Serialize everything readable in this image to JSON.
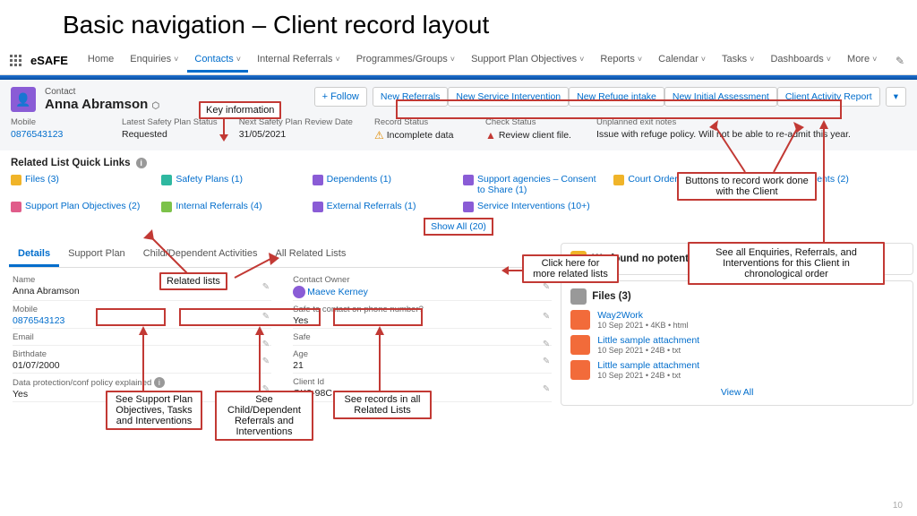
{
  "slide": {
    "title": "Basic navigation – Client record layout",
    "page": "10"
  },
  "brand": "eSAFE",
  "nav": {
    "items": [
      "Home",
      "Enquiries",
      "Contacts",
      "Internal Referrals",
      "Programmes/Groups",
      "Support Plan Objectives",
      "Reports",
      "Calendar",
      "Tasks",
      "Dashboards",
      "More"
    ],
    "active": "Contacts"
  },
  "contact": {
    "label": "Contact",
    "name": "Anna Abramson"
  },
  "actions": {
    "follow": "+ Follow",
    "buttons": [
      "New Referrals",
      "New Service Intervention",
      "New Refuge intake",
      "New Initial Assessment",
      "Client Activity Report"
    ]
  },
  "fields": [
    {
      "label": "Mobile",
      "value": "0876543123",
      "link": true
    },
    {
      "label": "Latest Safety Plan Status",
      "value": "Requested"
    },
    {
      "label": "Next Safety Plan Review Date",
      "value": "31/05/2021"
    },
    {
      "label": "Record Status",
      "value": "Incomplete data",
      "icon": "warn"
    },
    {
      "label": "Check Status",
      "value": "Review client file.",
      "icon": "err"
    },
    {
      "label": "Unplanned exit notes",
      "value": "Issue with refuge policy. Will not be able to re-admit this year."
    }
  ],
  "related": {
    "title": "Related List Quick Links",
    "links": [
      {
        "label": "Files (3)",
        "color": "#f0b429"
      },
      {
        "label": "Safety Plans (1)",
        "color": "#2eb8a0"
      },
      {
        "label": "Dependents (1)",
        "color": "#8a5cd6"
      },
      {
        "label": "Support agencies – Consent to Share (1)",
        "color": "#8a5cd6"
      },
      {
        "label": "Court Orders (2)",
        "color": "#f0b429"
      },
      {
        "label": "Assessments (2)",
        "color": "#e05c8a"
      },
      {
        "label": "Support Plan Objectives (2)",
        "color": "#e05c8a"
      },
      {
        "label": "Internal Referrals (4)",
        "color": "#7cc24a"
      },
      {
        "label": "External Referrals (1)",
        "color": "#8a5cd6"
      },
      {
        "label": "Service Interventions (10+)",
        "color": "#8a5cd6"
      }
    ],
    "show_all": "Show All (20)"
  },
  "tabs": [
    "Details",
    "Support Plan",
    "Child/Dependent Activities",
    "All Related Lists"
  ],
  "details": {
    "left": [
      {
        "label": "Name",
        "value": "Anna Abramson"
      },
      {
        "label": "Mobile",
        "value": "0876543123",
        "link": true
      },
      {
        "label": "Email",
        "value": ""
      },
      {
        "label": "Birthdate",
        "value": "01/07/2000"
      },
      {
        "label": "Data protection/conf policy explained",
        "value": "Yes",
        "info": true
      }
    ],
    "right": [
      {
        "label": "Contact Owner",
        "value": "Maeve Kerney",
        "link": true,
        "avatar": true
      },
      {
        "label": "Safe to contact on phone number?",
        "value": "Yes"
      },
      {
        "label": "Safe",
        "value": ""
      },
      {
        "label": "Age",
        "value": "21"
      },
      {
        "label": "Client Id",
        "value": "GK3-98C"
      }
    ]
  },
  "dupe": "We found no potential duplicates of this Contact.",
  "files": {
    "title": "Files (3)",
    "items": [
      {
        "name": "Way2Work",
        "meta": "10 Sep 2021 • 4KB • html"
      },
      {
        "name": "Little sample attachment",
        "meta": "10 Sep 2021 • 24B • txt"
      },
      {
        "name": "Little sample attachment",
        "meta": "10 Sep 2021 • 24B • txt"
      }
    ],
    "view_all": "View All"
  },
  "annots": {
    "key_info": "Key information",
    "buttons_work": "Buttons to record work done with the Client",
    "click_more": "Click here for more related lists",
    "see_all_enq": "See all Enquiries, Referrals, and Interventions for this Client in chronological order",
    "related_lists": "Related lists",
    "see_support": "See Support Plan Objectives, Tasks and Interventions",
    "see_child": "See Child/Dependent Referrals and Interventions",
    "see_records": "See records in all Related Lists"
  }
}
